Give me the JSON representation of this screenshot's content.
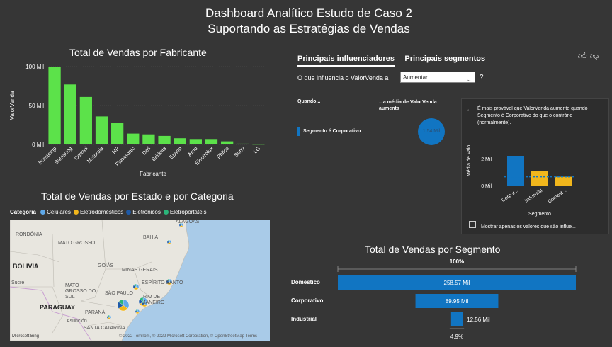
{
  "header": {
    "title_line1": "Dashboard Analítico Estudo de Caso 2",
    "title_line2": "Suportando as Estratégias de Vendas"
  },
  "chart_data": [
    {
      "type": "bar",
      "title": "Total de Vendas por Fabricante",
      "xlabel": "Fabricante",
      "ylabel": "ValorVenda",
      "yticks": [
        "0 Mil",
        "50 Mil",
        "100 Mil"
      ],
      "ylim": [
        0,
        100
      ],
      "categories": [
        "Brastemp",
        "Samsung",
        "Consul",
        "Motorola",
        "HP",
        "Panasonic",
        "Dell",
        "Britânia",
        "Epson",
        "Arno",
        "Electrolux",
        "Philco",
        "Sony",
        "LG"
      ],
      "values": [
        100,
        77,
        61,
        36,
        28,
        14,
        13,
        11,
        8,
        7,
        7,
        4,
        1,
        0.5
      ],
      "color": "#5ce24a"
    },
    {
      "type": "bar",
      "title": "Total de Vendas por Segmento",
      "categories": [
        "Doméstico",
        "Corporativo",
        "Industrial"
      ],
      "values": [
        258.57,
        89.95,
        12.56
      ],
      "value_labels": [
        "258.57 Mil",
        "89.95 Mil",
        "12.56 Mil"
      ],
      "top_label": "100%",
      "bottom_label": "4.9%",
      "color": "#1175c2"
    },
    {
      "type": "bar",
      "title": "",
      "ylabel": "Média de Valo...",
      "xlabel": "Segmento",
      "yticks": [
        "0 Mil",
        "2 Mil"
      ],
      "categories": [
        "Corpor...",
        "Industrial",
        "Domést..."
      ],
      "values": [
        2.2,
        1.1,
        0.65
      ],
      "colors": [
        "#1175c2",
        "#f1b61c",
        "#f1b61c"
      ],
      "average": 0.65
    }
  ],
  "map_panel": {
    "title": "Total de Vendas por Estado e por Categoria",
    "legend_title": "Categoria",
    "legend": [
      {
        "label": "Celulares",
        "color": "#5fa8e8"
      },
      {
        "label": "Eletrodomésticos",
        "color": "#f1b61c"
      },
      {
        "label": "Eletrônicos",
        "color": "#1e5aa8"
      },
      {
        "label": "Eletroportáteis",
        "color": "#2bb57a"
      }
    ],
    "places": [
      "RONDÔNIA",
      "MATO GROSSO",
      "BAHIA",
      "ALAGOAS",
      "BOLIVIA",
      "Sucre",
      "GOIÁS",
      "MINAS GERAIS",
      "MATO GROSSO DO SUL",
      "ESPÍRITO SANTO",
      "SÃO PAULO",
      "RIO DE JANEIRO",
      "PARAGUAY",
      "PARANÁ",
      "Asunción",
      "SANTA CATARINA"
    ],
    "attribution": "© 2022 TomTom, © 2022 Microsoft Corporation, © OpenStreetMap  Terms",
    "bing": "Microsoft Bing"
  },
  "influencers": {
    "tab_active": "Principais influenciadores",
    "tab_other": "Principais segmentos",
    "question": "O que influencia o ValorVenda a",
    "dropdown_value": "Aumentar",
    "help": "?",
    "col_when": "Quando...",
    "col_avg": "...a média de ValorVenda aumenta",
    "factor": "Segmento é Corporativo",
    "bubble": "1.54 Mil",
    "popup_text": "É mais provável que ValorVenda aumente quando Segmento é Corporativo do que o contrário (normalmente).",
    "checkbox_label": "Mostrar apenas os valores que são influe..."
  }
}
